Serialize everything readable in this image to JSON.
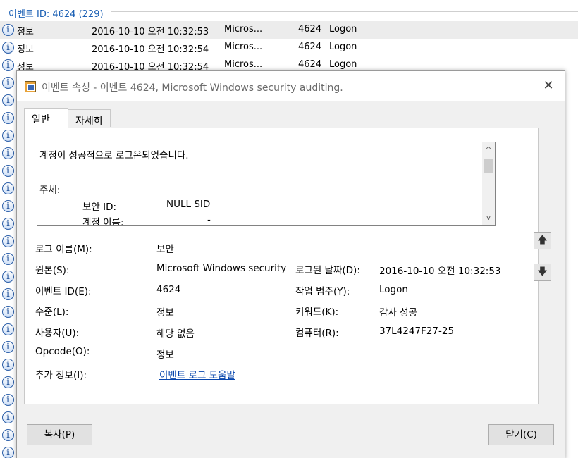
{
  "header": {
    "title": "이벤트 ID: 4624 (229)"
  },
  "rows": [
    {
      "level": "정보",
      "date": "2016-10-10 오전 10:32:53",
      "source": "Micros...",
      "id": "4624",
      "category": "Logon"
    },
    {
      "level": "정보",
      "date": "2016-10-10 오전 10:32:54",
      "source": "Micros...",
      "id": "4624",
      "category": "Logon"
    },
    {
      "level": "정보",
      "date": "2016-10-10 오전 10:32:54",
      "source": "Micros...",
      "id": "4624",
      "category": "Logon"
    }
  ],
  "icons": {
    "info": "i",
    "info_name": "info-icon",
    "close": "✕",
    "up_arrow": "🡅",
    "down_arrow": "🡇",
    "scroll_up": "^",
    "scroll_down": "v"
  },
  "dialog": {
    "title": "이벤트 속성 - 이벤트 4624, Microsoft Windows security auditing.",
    "tabs": {
      "general": "일반",
      "details": "자세히"
    },
    "description": {
      "line1": "계정이 성공적으로 로그온되었습니다.",
      "line2": "주체:",
      "line3_label": "보안 ID:",
      "line3_value": "NULL SID",
      "line4_label": "계정 이름:",
      "line4_value": "-"
    },
    "fields": {
      "log_name_label": "로그 이름(M):",
      "log_name_value": "보안",
      "source_label": "원본(S):",
      "source_value": "Microsoft Windows security",
      "logged_label": "로그된 날짜(D):",
      "logged_value": "2016-10-10 오전 10:32:53",
      "event_id_label": "이벤트 ID(E):",
      "event_id_value": "4624",
      "task_label": "작업 범주(Y):",
      "task_value": "Logon",
      "level_label": "수준(L):",
      "level_value": "정보",
      "keywords_label": "키워드(K):",
      "keywords_value": "감사 성공",
      "user_label": "사용자(U):",
      "user_value": "해당 없음",
      "computer_label": "컴퓨터(R):",
      "computer_value": "37L4247F27-25",
      "opcode_label": "Opcode(O):",
      "opcode_value": "정보",
      "more_label": "추가 정보(I):",
      "more_link": "이벤트 로그 도움말"
    },
    "buttons": {
      "copy": "복사(P)",
      "close": "닫기(C)"
    }
  }
}
